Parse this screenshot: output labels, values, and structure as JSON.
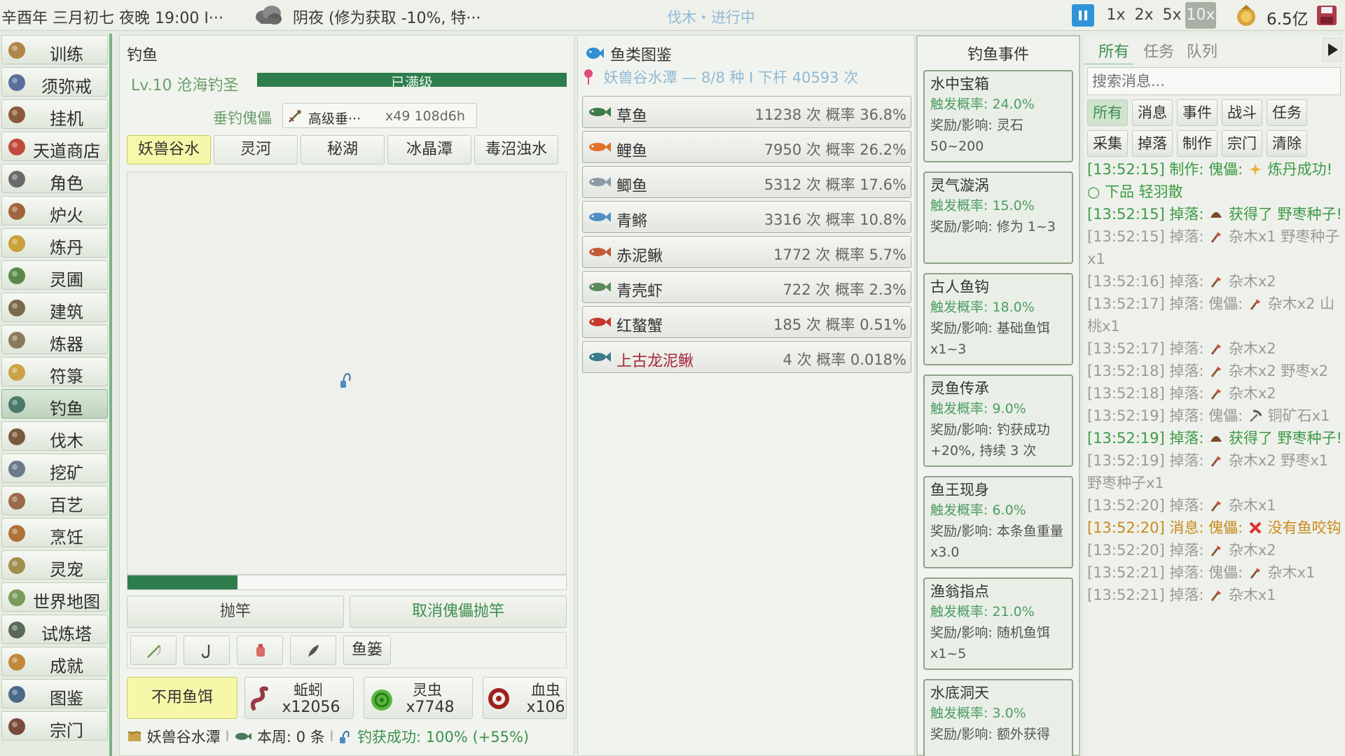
{
  "topbar": {
    "date": "辛酉年 三月初七 夜晚 19:00 I···",
    "weather": "阴夜 (修为获取 -10%, 特···",
    "center_status": "伐木・进行中",
    "speeds": [
      "1x",
      "2x",
      "5x",
      "10x"
    ],
    "active_speed": "10x",
    "money": "6.5亿"
  },
  "nav": {
    "items": [
      {
        "label": "训练",
        "icon": "scroll-icon"
      },
      {
        "label": "须弥戒",
        "icon": "bag-icon"
      },
      {
        "label": "挂机",
        "icon": "book-icon"
      },
      {
        "label": "天道商店",
        "icon": "shop-icon"
      },
      {
        "label": "角色",
        "icon": "character-icon"
      },
      {
        "label": "炉火",
        "icon": "furnace-icon"
      },
      {
        "label": "炼丹",
        "icon": "alchemy-icon"
      },
      {
        "label": "灵圃",
        "icon": "garden-icon"
      },
      {
        "label": "建筑",
        "icon": "building-icon"
      },
      {
        "label": "炼器",
        "icon": "forge-icon"
      },
      {
        "label": "符箓",
        "icon": "talisman-icon"
      },
      {
        "label": "钓鱼",
        "icon": "fishing-icon"
      },
      {
        "label": "伐木",
        "icon": "axe-icon"
      },
      {
        "label": "挖矿",
        "icon": "pickaxe-icon"
      },
      {
        "label": "百艺",
        "icon": "crafts-icon"
      },
      {
        "label": "烹饪",
        "icon": "cooking-icon"
      },
      {
        "label": "灵宠",
        "icon": "pet-icon"
      },
      {
        "label": "世界地图",
        "icon": "map-icon"
      },
      {
        "label": "试炼塔",
        "icon": "tower-icon"
      },
      {
        "label": "成就",
        "icon": "trophy-icon"
      },
      {
        "label": "图鉴",
        "icon": "codex-icon"
      },
      {
        "label": "宗门",
        "icon": "sect-icon"
      }
    ],
    "active": "钓鱼"
  },
  "fishing": {
    "title": "钓鱼",
    "level_label": "Lv.10 沧海钓圣",
    "level_bar_text": "已满级",
    "level_progress": 1.0,
    "puppet_label": "垂钓傀儡",
    "puppet_name": "高级垂···",
    "puppet_count": "x49 108d6h",
    "locations": [
      "妖兽谷水",
      "灵河",
      "秘湖",
      "冰晶潭",
      "毒沼浊水"
    ],
    "active_location": "妖兽谷水",
    "cast_progress": 0.25,
    "cast_button": "抛竿",
    "cancel_puppet_button": "取消傀儡抛竿",
    "tools": [
      "rod-icon",
      "hook-icon",
      "lure-icon",
      "feather-icon"
    ],
    "basket_button": "鱼篓",
    "no_bait": "不用鱼饵",
    "baits": [
      {
        "name": "蚯蚓",
        "count": "x12056",
        "icon": "worm-icon"
      },
      {
        "name": "灵虫",
        "count": "x7748",
        "icon": "spirit-bug-icon"
      },
      {
        "name": "血虫",
        "count": "x106",
        "icon": "blood-worm-icon"
      }
    ],
    "status_location": "妖兽谷水潭",
    "status_week": "本周: 0 条",
    "status_success": "钓获成功: 100% (+55%)"
  },
  "dex": {
    "title": "鱼类图鉴",
    "subtitle": "妖兽谷水潭 — 8/8 种 I 下杆 40593 次",
    "fish": [
      {
        "name": "草鱼",
        "stat": "11238 次  概率 36.8%",
        "color": "#3f7a4a"
      },
      {
        "name": "鲤鱼",
        "stat": "7950 次  概率 26.2%",
        "color": "#e0702a"
      },
      {
        "name": "鲫鱼",
        "stat": "5312 次  概率 17.6%",
        "color": "#8a9aa8"
      },
      {
        "name": "青鳉",
        "stat": "3316 次  概率 10.8%",
        "color": "#4e8fc4"
      },
      {
        "name": "赤泥鳅",
        "stat": "1772 次  概率 5.7%",
        "color": "#c25a3a"
      },
      {
        "name": "青壳虾",
        "stat": "722 次  概率 2.3%",
        "color": "#5a8a5a"
      },
      {
        "name": "红螯蟹",
        "stat": "185 次  概率 0.51%",
        "color": "#c8362c"
      },
      {
        "name": "上古龙泥鳅",
        "stat": "4 次  概率 0.018%",
        "color": "#3a7a8c",
        "legend": true
      }
    ]
  },
  "events": {
    "title": "钓鱼事件",
    "items": [
      {
        "title": "水中宝箱",
        "rate": "触发概率: 24.0%",
        "effect": "奖励/影响: 灵石 50~200"
      },
      {
        "title": "灵气漩涡",
        "rate": "触发概率: 15.0%",
        "effect": "奖励/影响: 修为 1~3"
      },
      {
        "title": "古人鱼钩",
        "rate": "触发概率: 18.0%",
        "effect": "奖励/影响: 基础鱼饵 x1~3"
      },
      {
        "title": "灵鱼传承",
        "rate": "触发概率: 9.0%",
        "effect": "奖励/影响: 钓获成功 +20%, 持续 3 次"
      },
      {
        "title": "鱼王现身",
        "rate": "触发概率: 6.0%",
        "effect": "奖励/影响: 本条鱼重量 x3.0"
      },
      {
        "title": "渔翁指点",
        "rate": "触发概率: 21.0%",
        "effect": "奖励/影响: 随机鱼饵 x1~5"
      },
      {
        "title": "水底洞天",
        "rate": "触发概率: 3.0%",
        "effect": "奖励/影响: 额外获得"
      }
    ]
  },
  "log": {
    "tabs": [
      "所有",
      "任务",
      "队列"
    ],
    "active_tab": "所有",
    "search_placeholder": "搜索消息...",
    "filters_row1": [
      "所有",
      "消息",
      "事件",
      "战斗",
      "任务"
    ],
    "filters_row2": [
      "采集",
      "掉落",
      "制作",
      "宗门",
      "清除"
    ],
    "active_filter": "所有",
    "lines": [
      {
        "type": "craft",
        "pre": "[13:52:15] 制作: 傀儡: ",
        "icon": "pill-icon",
        "post": " 炼丹成功! ○ 下品 轻羽散"
      },
      {
        "type": "drop-green",
        "pre": "[13:52:15] 掉落: ",
        "icon": "seed-icon",
        "post": " 获得了 野枣种子!"
      },
      {
        "type": "drop",
        "pre": "[13:52:15] 掉落: ",
        "icon": "wood-icon",
        "post": " 杂木x1 野枣种子x1"
      },
      {
        "type": "drop",
        "pre": "[13:52:16] 掉落: ",
        "icon": "wood-icon",
        "post": " 杂木x2"
      },
      {
        "type": "drop",
        "pre": "[13:52:17] 掉落: 傀儡: ",
        "icon": "wood-icon",
        "post": " 杂木x2 山桃x1"
      },
      {
        "type": "drop",
        "pre": "[13:52:17] 掉落: ",
        "icon": "wood-icon",
        "post": " 杂木x2"
      },
      {
        "type": "drop",
        "pre": "[13:52:18] 掉落: ",
        "icon": "wood-icon",
        "post": " 杂木x2 野枣x2"
      },
      {
        "type": "drop",
        "pre": "[13:52:18] 掉落: ",
        "icon": "wood-icon",
        "post": " 杂木x2"
      },
      {
        "type": "drop",
        "pre": "[13:52:19] 掉落: 傀儡: ",
        "icon": "pick-icon",
        "post": " 铜矿石x1"
      },
      {
        "type": "drop-green",
        "pre": "[13:52:19] 掉落: ",
        "icon": "seed-icon",
        "post": " 获得了 野枣种子!"
      },
      {
        "type": "drop",
        "pre": "[13:52:19] 掉落: ",
        "icon": "wood-icon",
        "post": " 杂木x2 野枣x1 野枣种子x1"
      },
      {
        "type": "drop",
        "pre": "[13:52:20] 掉落: ",
        "icon": "wood-icon",
        "post": " 杂木x1"
      },
      {
        "type": "msg",
        "pre": "[13:52:20] 消息: 傀儡: ",
        "icon": "cross-icon",
        "post": " 没有鱼咬钩"
      },
      {
        "type": "drop",
        "pre": "[13:52:20] 掉落: ",
        "icon": "wood-icon",
        "post": " 杂木x2"
      },
      {
        "type": "drop",
        "pre": "[13:52:21] 掉落: 傀儡: ",
        "icon": "wood-icon",
        "post": " 杂木x1"
      },
      {
        "type": "drop",
        "pre": "[13:52:21] 掉落: ",
        "icon": "wood-icon",
        "post": " 杂木x1"
      }
    ]
  }
}
